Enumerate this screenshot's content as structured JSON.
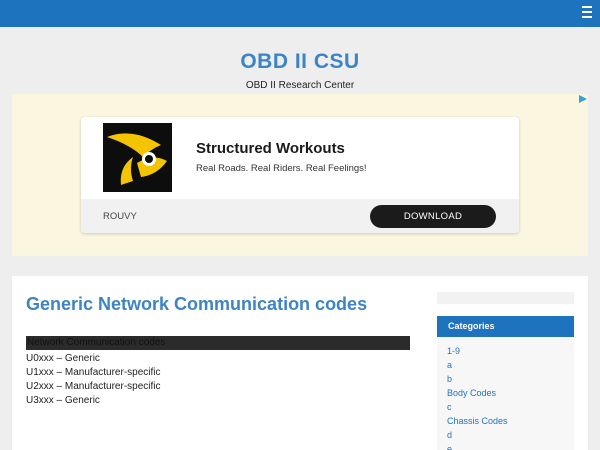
{
  "site": {
    "title": "OBD II CSU",
    "tagline": "OBD II Research Center"
  },
  "ad": {
    "headline": "Structured Workouts",
    "subtext": "Real Roads. Real Riders. Real Feelings!",
    "brand": "ROUVY",
    "cta_label": "DOWNLOAD"
  },
  "post": {
    "title": "Generic Network Communication codes",
    "code_header": "Network Communication codes",
    "codes": [
      "U0xxx – Generic",
      "U1xxx – Manufacturer-specific",
      "U2xxx – Manufacturer-specific",
      "U3xxx – Generic"
    ]
  },
  "sidebar": {
    "categories_title": "Categories",
    "categories": [
      "1-9",
      "a",
      "b",
      "Body Codes",
      "c",
      "Chassis Codes",
      "d",
      "e"
    ]
  },
  "icons": {
    "menu": "hamburger-menu-icon",
    "ad_logo": "rouvy-logo-icon",
    "ad_choices": "adchoices-icon"
  },
  "colors": {
    "accent": "#1e73be",
    "title_blue": "#3d84c4",
    "logo_yellow": "#f5c400"
  }
}
